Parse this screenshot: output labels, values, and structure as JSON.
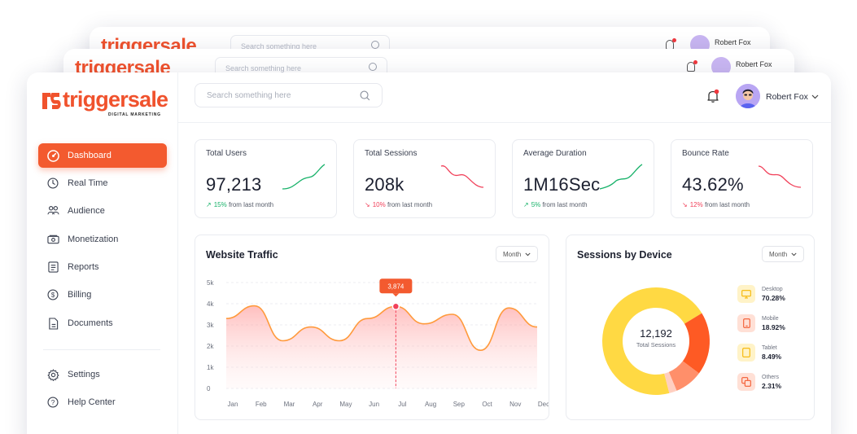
{
  "app": {
    "logo_text": "triggersale",
    "logo_sub": "DIGITAL MARKETING"
  },
  "search": {
    "placeholder": "Search something here"
  },
  "user": {
    "name": "Robert Fox"
  },
  "sidebar": {
    "items": [
      {
        "label": "Dashboard",
        "icon": "dashboard-gauge-icon",
        "active": true
      },
      {
        "label": "Real Time",
        "icon": "clock-icon"
      },
      {
        "label": "Audience",
        "icon": "users-icon"
      },
      {
        "label": "Monetization",
        "icon": "money-icon"
      },
      {
        "label": "Reports",
        "icon": "document-icon"
      },
      {
        "label": "Billing",
        "icon": "dollar-circle-icon"
      },
      {
        "label": "Documents",
        "icon": "file-icon"
      }
    ],
    "bottom": [
      {
        "label": "Settings",
        "icon": "gear-icon"
      },
      {
        "label": "Help Center",
        "icon": "question-icon"
      }
    ]
  },
  "stats": [
    {
      "label": "Total Users",
      "value": "97,213",
      "change": "15%",
      "suffix": "from last month",
      "trend": "up"
    },
    {
      "label": "Total Sessions",
      "value": "208k",
      "change": "10%",
      "suffix": "from last month",
      "trend": "down"
    },
    {
      "label": "Average Duration",
      "value": "1M16Sec",
      "change": "5%",
      "suffix": "from last month",
      "trend": "up"
    },
    {
      "label": "Bounce Rate",
      "value": "43.62%",
      "change": "12%",
      "suffix": "from last month",
      "trend": "down"
    }
  ],
  "traffic": {
    "title": "Website Traffic",
    "filter": "Month",
    "tooltip": "3,874"
  },
  "devices": {
    "title": "Sessions by Device",
    "filter": "Month",
    "center_value": "12,192",
    "center_label": "Total Sessions"
  },
  "colors": {
    "accent": "#f35a2f",
    "up": "#18b26a",
    "down": "#f1415a",
    "desktop": "#ffd943",
    "mobile": "#fe5a24",
    "tablet": "#ffc74d",
    "others": "#ffcfc0"
  },
  "chart_data": [
    {
      "type": "area",
      "title": "Website Traffic",
      "categories": [
        "Jan",
        "Feb",
        "Mar",
        "Apr",
        "May",
        "Jun",
        "Jul",
        "Aug",
        "Sep",
        "Oct",
        "Nov",
        "Dec"
      ],
      "y_ticks": [
        "0",
        "1k",
        "2k",
        "3k",
        "4k",
        "5k"
      ],
      "ylim": [
        0,
        5000
      ],
      "values": [
        3300,
        3900,
        2250,
        2900,
        2250,
        3300,
        3874,
        3050,
        3500,
        1800,
        3800,
        2900
      ],
      "highlight": {
        "category": "Jul",
        "value": 3874
      },
      "grid": true
    },
    {
      "type": "pie",
      "title": "Sessions by Device",
      "series": [
        {
          "name": "Desktop",
          "value": 70.28,
          "label": "70.28%"
        },
        {
          "name": "Mobile",
          "value": 18.92,
          "label": "18.92%"
        },
        {
          "name": "Tablet",
          "value": 8.49,
          "label": "8.49%"
        },
        {
          "name": "Others",
          "value": 2.31,
          "label": "2.31%"
        }
      ],
      "legend": "right"
    }
  ]
}
